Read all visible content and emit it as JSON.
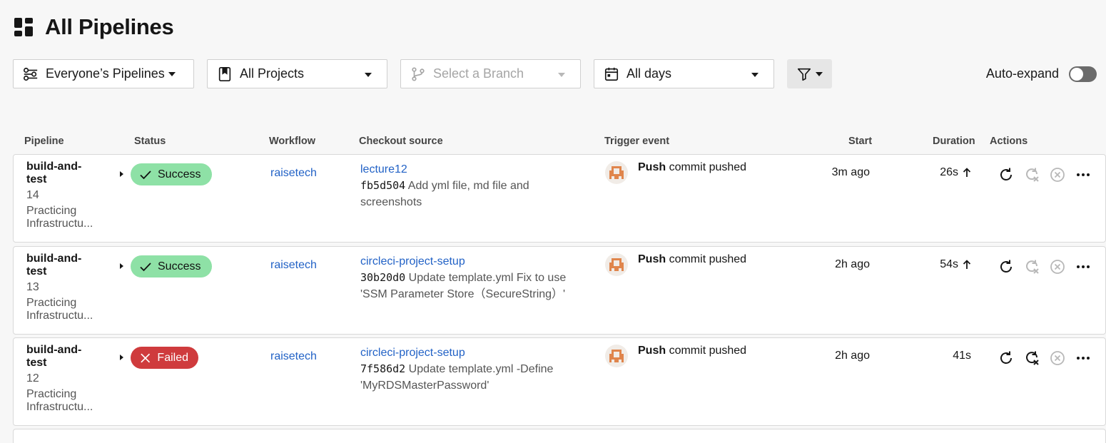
{
  "page": {
    "title": "All Pipelines"
  },
  "filters": {
    "owner": "Everyone’s Pipelines",
    "project": "All Projects",
    "branch_placeholder": "Select a Branch",
    "date": "All days",
    "auto_expand_label": "Auto-expand",
    "auto_expand_on": false
  },
  "table": {
    "headers": {
      "pipeline": "Pipeline",
      "status": "Status",
      "workflow": "Workflow",
      "checkout": "Checkout source",
      "trigger": "Trigger event",
      "start": "Start",
      "duration": "Duration",
      "actions": "Actions"
    },
    "rows": [
      {
        "pipeline_name": "build-and-test",
        "number": "14",
        "project": "Practicing Infrastructu...",
        "status": "Success",
        "workflow": "raisetech",
        "branch": "lecture12",
        "sha": "fb5d504",
        "message": "Add yml file, md file and screenshots",
        "trigger_type": "Push",
        "trigger_text": "commit pushed",
        "start": "3m ago",
        "duration": "26s"
      },
      {
        "pipeline_name": "build-and-test",
        "number": "13",
        "project": "Practicing Infrastructu...",
        "status": "Success",
        "workflow": "raisetech",
        "branch": "circleci-project-setup",
        "sha": "30b20d0",
        "message": "Update template.yml Fix to use 'SSM Parameter Store（SecureString）'",
        "trigger_type": "Push",
        "trigger_text": "commit pushed",
        "start": "2h ago",
        "duration": "54s"
      },
      {
        "pipeline_name": "build-and-test",
        "number": "12",
        "project": "Practicing Infrastructu...",
        "status": "Failed",
        "workflow": "raisetech",
        "branch": "circleci-project-setup",
        "sha": "7f586d2",
        "message": "Update template.yml -Define 'MyRDSMasterPassword'",
        "trigger_type": "Push",
        "trigger_text": "commit pushed",
        "start": "2h ago",
        "duration": "41s"
      }
    ]
  },
  "colors": {
    "success": "#8ee1a6",
    "failed": "#cf3b3d",
    "link": "#2262c6"
  }
}
